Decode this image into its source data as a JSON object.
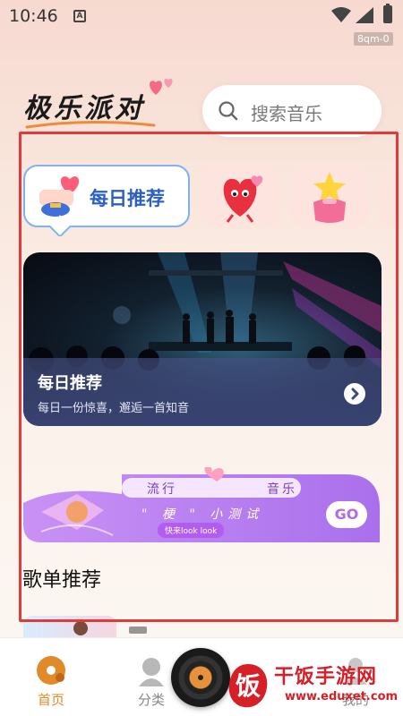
{
  "status_bar": {
    "time": "10:46",
    "app_badge": "A",
    "tag": "8qm-0"
  },
  "header": {
    "logo_text": "极乐派对",
    "search_placeholder": "搜索音乐"
  },
  "categories": [
    {
      "label": "每日推荐",
      "active": true,
      "icon": "gift-heart-icon"
    },
    {
      "label": "",
      "active": false,
      "icon": "heart-mascot-icon"
    },
    {
      "label": "",
      "active": false,
      "icon": "star-bag-icon"
    }
  ],
  "banner": {
    "title": "每日推荐",
    "subtitle": "每日一份惊喜，邂逅一首知音"
  },
  "promo": {
    "left_text": "流行",
    "right_text": "音乐",
    "slogan": "\" 梗 \" 小测试",
    "tag": "快来look look",
    "go": "GO"
  },
  "section": {
    "title": "歌单推荐"
  },
  "nav": [
    {
      "label": "首页",
      "icon": "home-disc-icon",
      "active": true
    },
    {
      "label": "分类",
      "icon": "category-user-icon",
      "active": false
    },
    {
      "label": "我的",
      "icon": "profile-icon",
      "active": false
    }
  ],
  "watermark": {
    "name": "干饭手游网",
    "url": "www.eduxet.com",
    "seal": "饭"
  },
  "colors": {
    "accent": "#e08a2a",
    "highlight_frame": "#e03a3a",
    "active_card_text": "#2a5fc4"
  }
}
